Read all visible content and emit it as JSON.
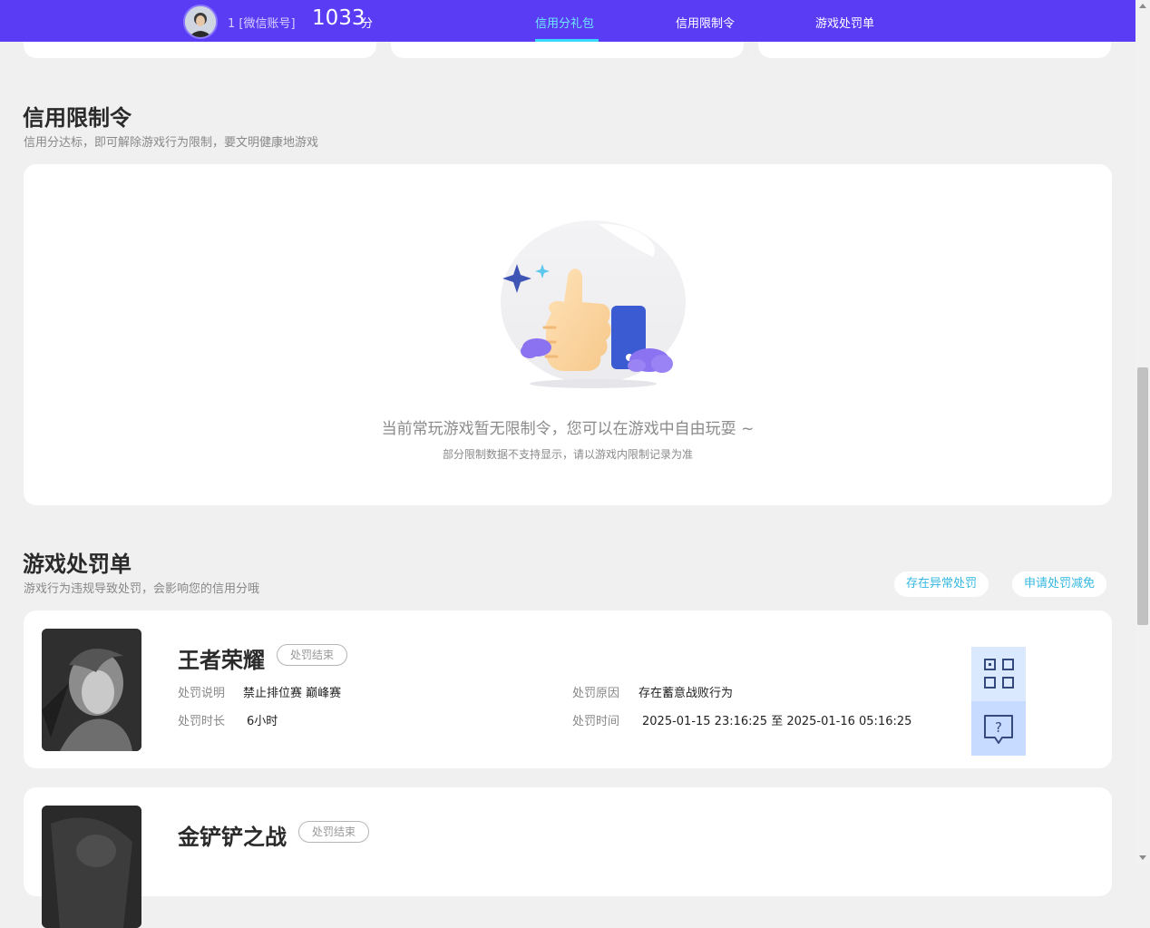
{
  "header": {
    "user_id": "1 [微信账号]",
    "score": "1033",
    "score_unit": "分",
    "nav": [
      "信用分礼包",
      "信用限制令",
      "游戏处罚单"
    ]
  },
  "restriction": {
    "title": "信用限制令",
    "subtitle": "信用分达标，即可解除游戏行为限制，要文明健康地游戏",
    "empty_main": "当前常玩游戏暂无限制令，您可以在游戏中自由玩耍 ~",
    "empty_note": "部分限制数据不支持显示，请以游戏内限制记录为准"
  },
  "penalty": {
    "title": "游戏处罚单",
    "subtitle": "游戏行为违规导致处罚，会影响您的信用分哦",
    "btn_abnormal": "存在异常处罚",
    "btn_appeal": "申请处罚减免",
    "labels": {
      "desc": "处罚说明",
      "reason": "处罚原因",
      "duration": "处罚时长",
      "time": "处罚时间"
    },
    "cards": [
      {
        "game": "王者荣耀",
        "status": "处罚结束",
        "desc": "禁止排位赛 巅峰赛",
        "reason": "存在蓄意战败行为",
        "duration": "6小时",
        "time": "2025-01-15 23:16:25 至 2025-01-16 05:16:25"
      },
      {
        "game": "金铲铲之战",
        "status": "处罚结束"
      }
    ]
  },
  "icons": {
    "qr": "qr-code-icon",
    "help": "help-bubble-icon",
    "illustration": "thumbs-up-illustration"
  },
  "colors": {
    "topbar": "#5b3cf5",
    "nav_active": "#6fe8ff",
    "accent_link": "#35b8e0",
    "icon_blue": "#3a5bd1"
  }
}
